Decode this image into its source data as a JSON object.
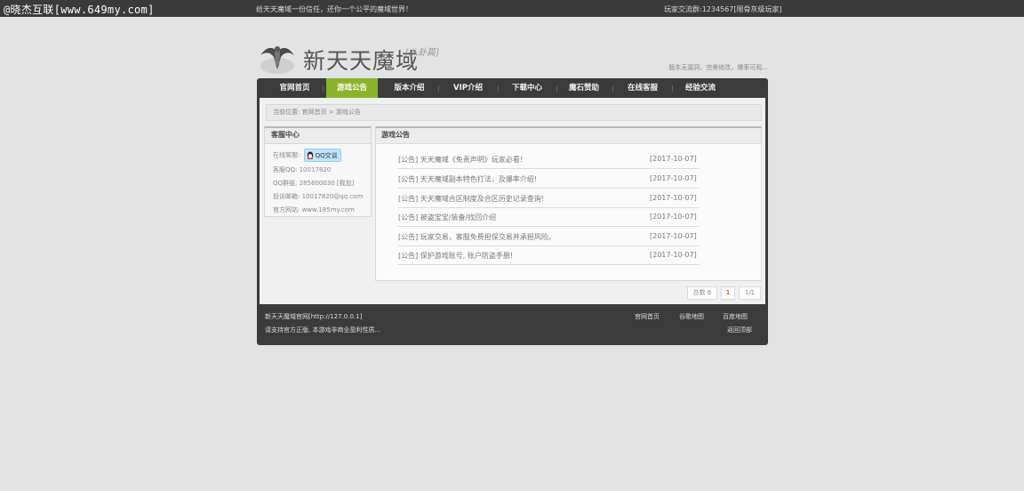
{
  "topbar": {
    "watermark": "@晓杰互联[www.649my.com]",
    "slogan": "给天天魔域一份信任，还你一个公平的魔域世界！",
    "qq_group": "玩家交流群:1234567[限骨灰级玩家]"
  },
  "header": {
    "title": "新天天魔域",
    "subtitle": "[八卦篇]",
    "tagline": "版本无漏洞，完美修改，爆率可观..."
  },
  "nav": {
    "items": [
      {
        "label": "官网首页"
      },
      {
        "label": "游戏公告",
        "active": true
      },
      {
        "label": "版本介绍"
      },
      {
        "label": "VIP介绍"
      },
      {
        "label": "下载中心"
      },
      {
        "label": "魔石赞助"
      },
      {
        "label": "在线客服"
      },
      {
        "label": "经验交流"
      }
    ]
  },
  "breadcrumb": "当前位置: 官网首页 > 游戏公告",
  "sidebar": {
    "title": "客服中心",
    "online_label": "在线客服:",
    "qq_button": "QQ交谈",
    "qq": "客服QQ: 10017820",
    "group": "QQ群组: 285600030 [我加]",
    "email": "投诉邮箱: 10017820@qq.com",
    "website": "官方网站: www.185my.com"
  },
  "main": {
    "title": "游戏公告",
    "news": [
      {
        "title": "[公告] 天天魔域《免责声明》玩家必看！",
        "date": "[2017-10-07]"
      },
      {
        "title": "[公告] 天天魔域副本特色打法，及爆率介绍!",
        "date": "[2017-10-07]"
      },
      {
        "title": "[公告] 天天魔域合区制度及合区历史记录查询!",
        "date": "[2017-10-07]"
      },
      {
        "title": "[公告] 被盗宝宝/装备/找回介绍",
        "date": "[2017-10-07]"
      },
      {
        "title": "[公告] 玩家交易，客服免费担保交易并承担风险。",
        "date": "[2017-10-07]"
      },
      {
        "title": "[公告] 保护游戏账号, 账户防盗手册!",
        "date": "[2017-10-07]"
      }
    ]
  },
  "pager": {
    "total": "总数 6",
    "current": "1",
    "pages": "1/1"
  },
  "footer": {
    "site": "新天天魔域官网[http://127.0.0.1]",
    "notice": "请支持官方正版, 本游戏非商业盈利性质...",
    "home": "官网首页",
    "google_map": "谷歌地图",
    "baidu_map": "百度地图",
    "back_top": "返回顶部"
  },
  "colors": {
    "nav_active": "#8ab32a",
    "frame": "#3b3b3b",
    "topbar": "#3a3a3a"
  }
}
